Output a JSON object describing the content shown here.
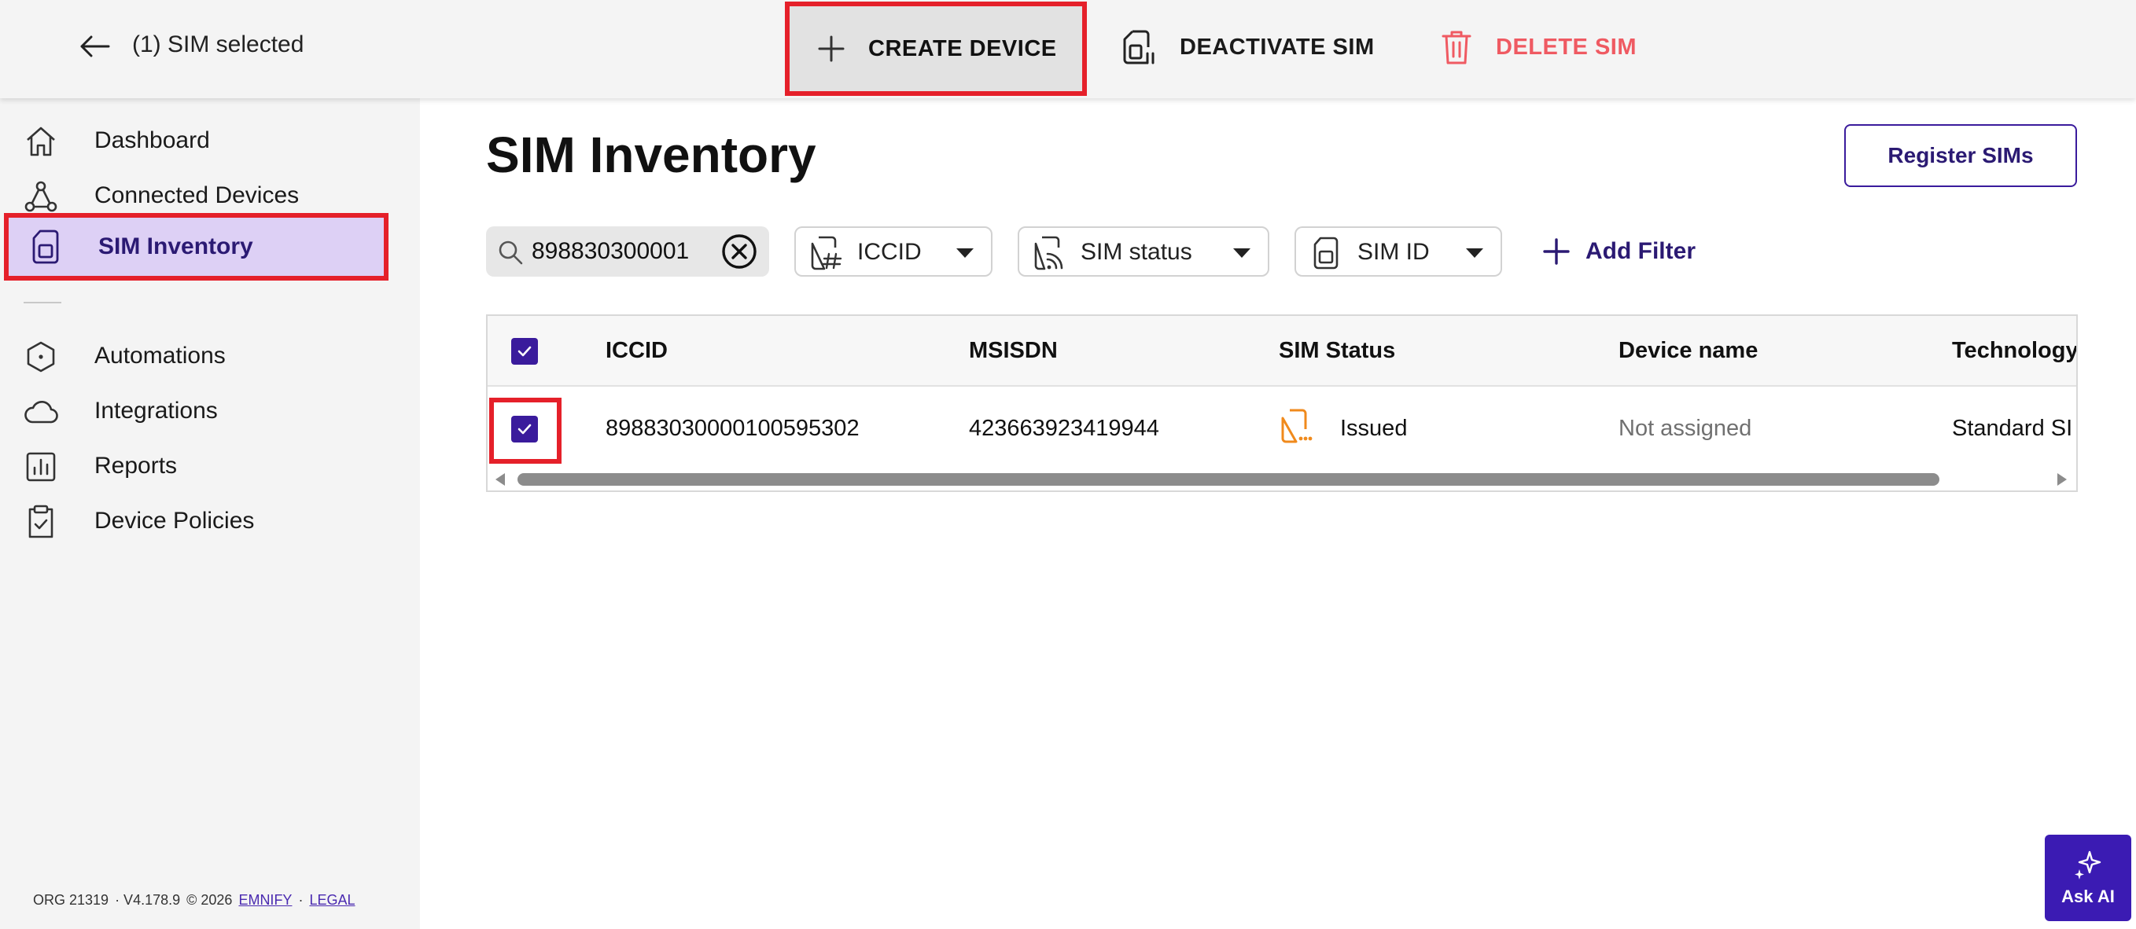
{
  "topbar": {
    "selection_text": "(1) SIM selected",
    "actions": {
      "create": "CREATE DEVICE",
      "deactivate": "DEACTIVATE SIM",
      "delete": "DELETE SIM"
    }
  },
  "sidebar": {
    "items": [
      {
        "label": "Dashboard",
        "icon": "home-icon"
      },
      {
        "label": "Connected Devices",
        "icon": "network-icon"
      },
      {
        "label": "SIM Inventory",
        "icon": "sim-icon",
        "active": true
      },
      {
        "label": "Automations",
        "icon": "hexagon-icon"
      },
      {
        "label": "Integrations",
        "icon": "cloud-icon"
      },
      {
        "label": "Reports",
        "icon": "bar-chart-icon"
      },
      {
        "label": "Device Policies",
        "icon": "clipboard-check-icon"
      }
    ],
    "footer": {
      "org": "ORG 21319",
      "version": "· V4.178.9",
      "copyright": "© 2026",
      "brand_link": "EMNIFY",
      "separator": "·",
      "legal_link": "LEGAL"
    }
  },
  "page": {
    "title": "SIM Inventory",
    "register_button": "Register SIMs"
  },
  "filters": {
    "search_value": "898830300001",
    "chips": [
      "ICCID",
      "SIM status",
      "SIM ID"
    ],
    "add_filter": "Add Filter"
  },
  "table": {
    "columns": [
      "ICCID",
      "MSISDN",
      "SIM Status",
      "Device name",
      "Technology"
    ],
    "rows": [
      {
        "selected": true,
        "iccid": "89883030000100595302",
        "msisdn": "423663923419944",
        "status": "Issued",
        "device_name": "Not assigned",
        "technology": "Standard SI"
      }
    ]
  },
  "assistant": {
    "label": "Ask AI"
  },
  "colors": {
    "accent": "#3a1b9c",
    "active_nav_bg": "#ddd0f5",
    "delete_red": "#ef5a62",
    "status_issued": "#f08a1c",
    "highlight_frame": "#e5202a"
  }
}
